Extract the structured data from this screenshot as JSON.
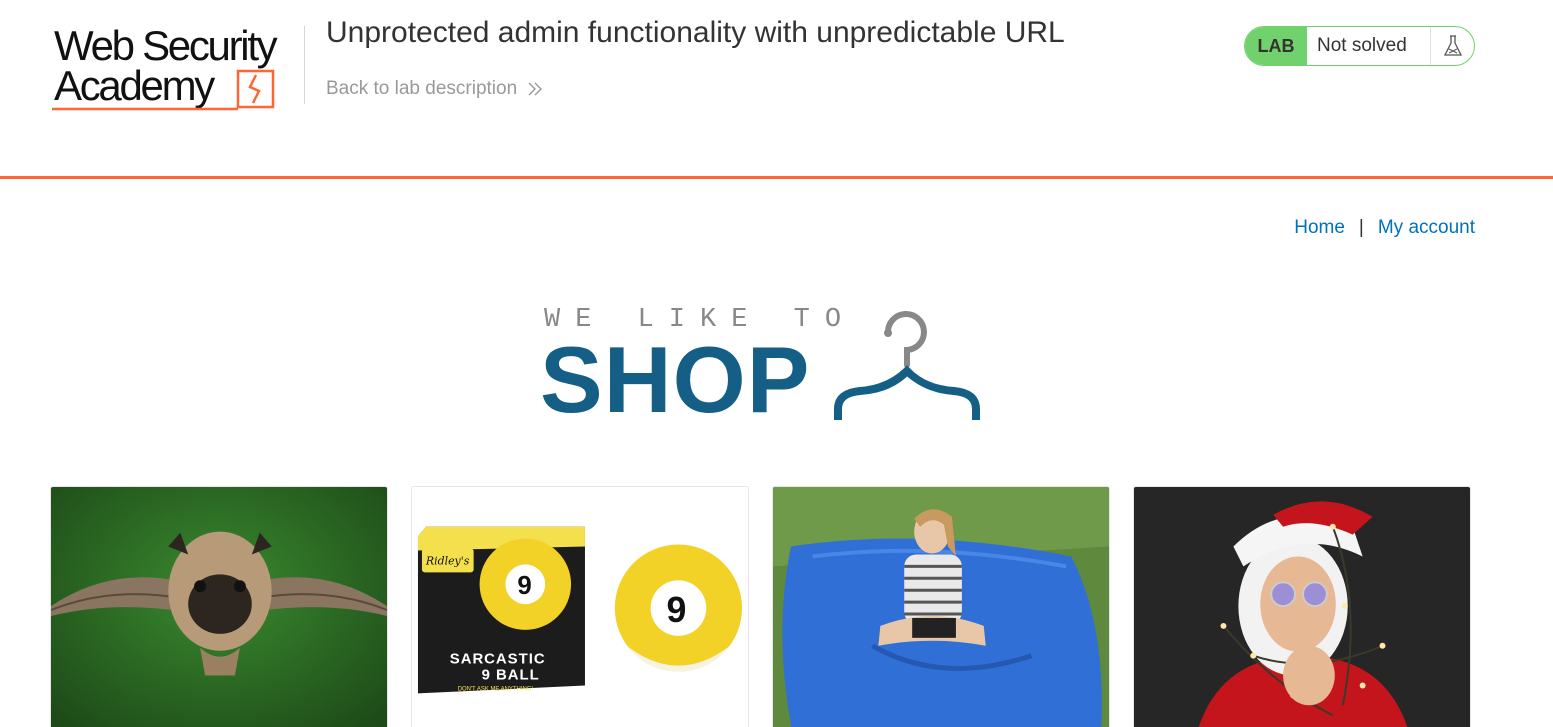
{
  "lab": {
    "logo_line1": "Web Security",
    "logo_line2": "Academy",
    "title": "Unprotected admin functionality with unpredictable URL",
    "back_link": "Back to lab description",
    "status_badge": "LAB",
    "status_text": "Not solved",
    "accent_color": "#ff6633",
    "status_color": "#70d16d"
  },
  "nav": {
    "home": "Home",
    "separator": "|",
    "my_account": "My account"
  },
  "banner": {
    "small_text": "WE LIKE TO",
    "big_text": "SHOP",
    "color": "#155f87"
  },
  "products": [
    {
      "image": "flying-pug-image"
    },
    {
      "image": "sarcastic-9-ball-image",
      "box_brand": "Ridley's",
      "box_line1": "SARCASTIC",
      "box_line2": "9 BALL",
      "box_tag": "DON'T ASK ME ANYTHING!",
      "ball_number": "9"
    },
    {
      "image": "inflatable-bean-bag-image"
    },
    {
      "image": "santa-lights-image"
    }
  ]
}
